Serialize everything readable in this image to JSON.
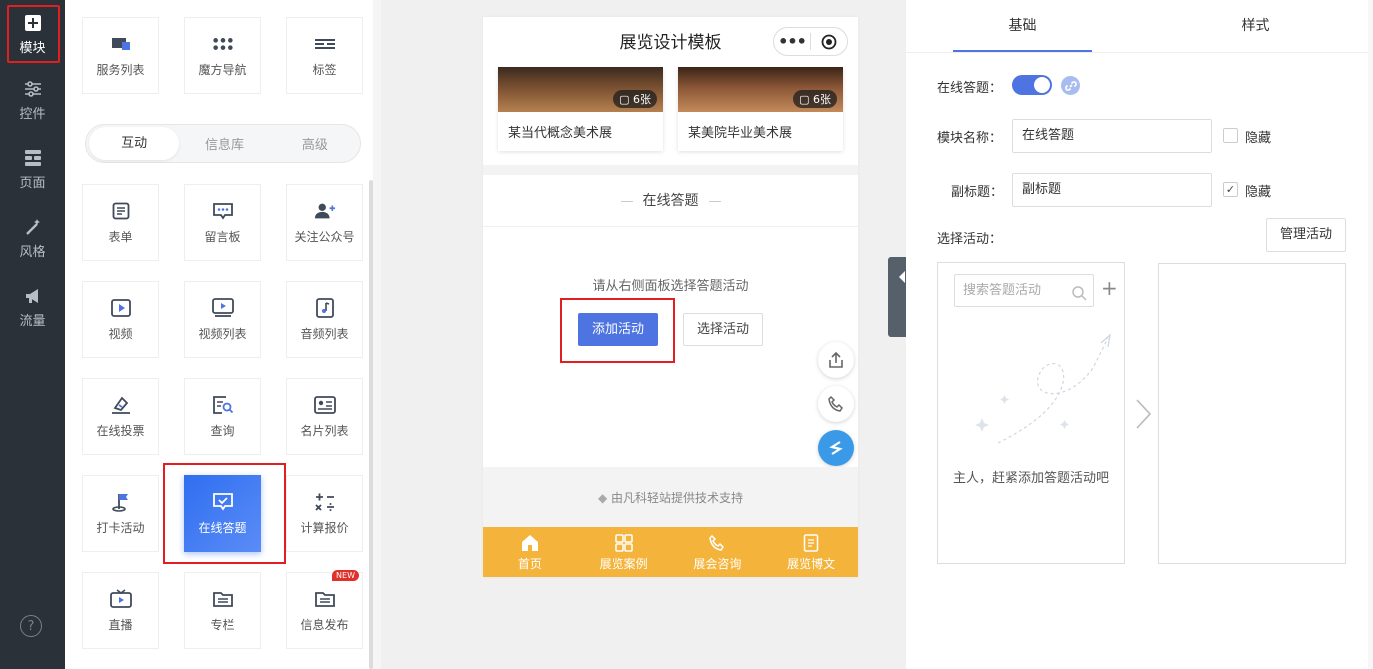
{
  "leftnav": {
    "items": [
      {
        "label": "模块",
        "icon": "plus-square-icon"
      },
      {
        "label": "控件",
        "icon": "sliders-icon"
      },
      {
        "label": "页面",
        "icon": "layout-icon"
      },
      {
        "label": "风格",
        "icon": "magic-wand-icon"
      },
      {
        "label": "流量",
        "icon": "megaphone-icon"
      }
    ],
    "help": "?"
  },
  "modules": {
    "top": [
      {
        "label": "服务列表",
        "icon": "service-list-icon"
      },
      {
        "label": "魔方导航",
        "icon": "grid-dots-icon"
      },
      {
        "label": "标签",
        "icon": "tag-lines-icon"
      }
    ],
    "tabs": [
      "互动",
      "信息库",
      "高级"
    ],
    "active_tab": "互动",
    "grid": [
      {
        "label": "表单",
        "icon": "form-icon"
      },
      {
        "label": "留言板",
        "icon": "message-board-icon"
      },
      {
        "label": "关注公众号",
        "icon": "follow-user-icon"
      },
      {
        "label": "视频",
        "icon": "video-icon"
      },
      {
        "label": "视频列表",
        "icon": "video-list-icon"
      },
      {
        "label": "音频列表",
        "icon": "audio-list-icon"
      },
      {
        "label": "在线投票",
        "icon": "vote-icon"
      },
      {
        "label": "查询",
        "icon": "query-icon"
      },
      {
        "label": "名片列表",
        "icon": "card-list-icon"
      },
      {
        "label": "打卡活动",
        "icon": "checkin-flag-icon"
      },
      {
        "label": "在线答题",
        "icon": "quiz-icon"
      },
      {
        "label": "计算报价",
        "icon": "calculator-icon"
      },
      {
        "label": "直播",
        "icon": "live-tv-icon"
      },
      {
        "label": "专栏",
        "icon": "column-icon"
      },
      {
        "label": "信息发布",
        "icon": "info-publish-icon"
      }
    ],
    "new_badge": "NEW"
  },
  "preview": {
    "title": "展览设计模板",
    "capsule_menu": "•••",
    "photos": [
      {
        "count": "6张",
        "caption": "某当代概念美术展"
      },
      {
        "count": "6张",
        "caption": "某美院毕业美术展"
      }
    ],
    "section_title": "在线答题",
    "hint": "请从右侧面板选择答题活动",
    "add_button": "添加活动",
    "select_button": "选择活动",
    "footer": "由凡科轻站提供技术支持",
    "tabbar": [
      {
        "label": "首页",
        "icon": "home-icon"
      },
      {
        "label": "展览案例",
        "icon": "grid-four-icon"
      },
      {
        "label": "展会咨询",
        "icon": "phone-icon"
      },
      {
        "label": "展览博文",
        "icon": "document-icon"
      }
    ]
  },
  "settings": {
    "tabs": [
      "基础",
      "样式"
    ],
    "active_tab": "基础",
    "online_quiz_label": "在线答题：",
    "online_quiz_on": true,
    "module_name_label": "模块名称：",
    "module_name_value": "在线答题",
    "hide_label": "隐藏",
    "module_name_hidden": false,
    "subtitle_label": "副标题：",
    "subtitle_value": "副标题",
    "subtitle_hidden": true,
    "choose_activity_label": "选择活动：",
    "manage_button": "管理活动",
    "search_placeholder": "搜索答题活动",
    "empty_text": "主人，赶紧添加答题活动吧"
  },
  "colors": {
    "accent": "#4d74e0",
    "nav_bg": "#2b3139",
    "tabbar": "#f4b43c",
    "highlight": "#e02020"
  }
}
